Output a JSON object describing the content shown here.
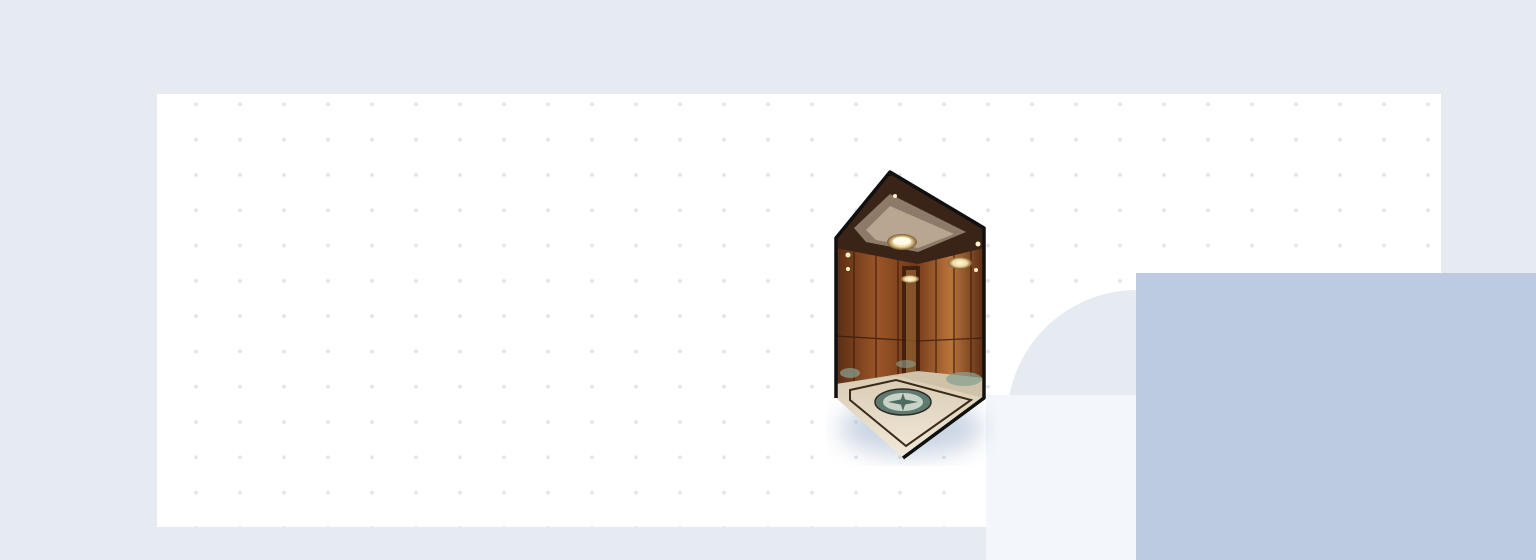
{
  "scene": {
    "image": {
      "subject": "elevator-cabin",
      "colors": {
        "wood_dark": "#4a2512",
        "wood_mid": "#8a4a22",
        "wood_light": "#c07a3c",
        "ceiling": "#3a2418",
        "floor": "#e8ddc8",
        "medallion": "#5f7a70",
        "frame": "#101010"
      }
    },
    "colors": {
      "background": "#e6ebf2",
      "card": "#ffffff",
      "dots": "#e1e4e9",
      "pale_panel": "#f3f7fc",
      "blue_panel": "#bccbe1"
    }
  }
}
